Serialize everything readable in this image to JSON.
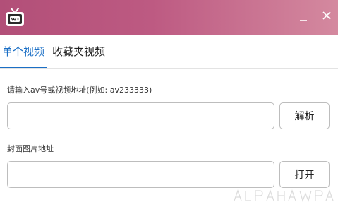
{
  "window": {
    "minimize_glyph": "—",
    "close_glyph": "✕"
  },
  "tabs": [
    {
      "label": "单个视频",
      "active": true
    },
    {
      "label": "收藏夹视频",
      "active": false
    }
  ],
  "video_section": {
    "label": "请输入av号或视频地址(例如: av233333)",
    "input_value": "",
    "button_label": "解析"
  },
  "cover_section": {
    "label": "封面图片地址",
    "input_value": "",
    "button_label": "打开"
  },
  "colors": {
    "titlebar_start": "#b24f78",
    "titlebar_end": "#d4899f",
    "accent": "#1b6fc5"
  },
  "icons": {
    "app": "tv-icon",
    "minimize": "minimize-icon",
    "close": "close-icon"
  }
}
